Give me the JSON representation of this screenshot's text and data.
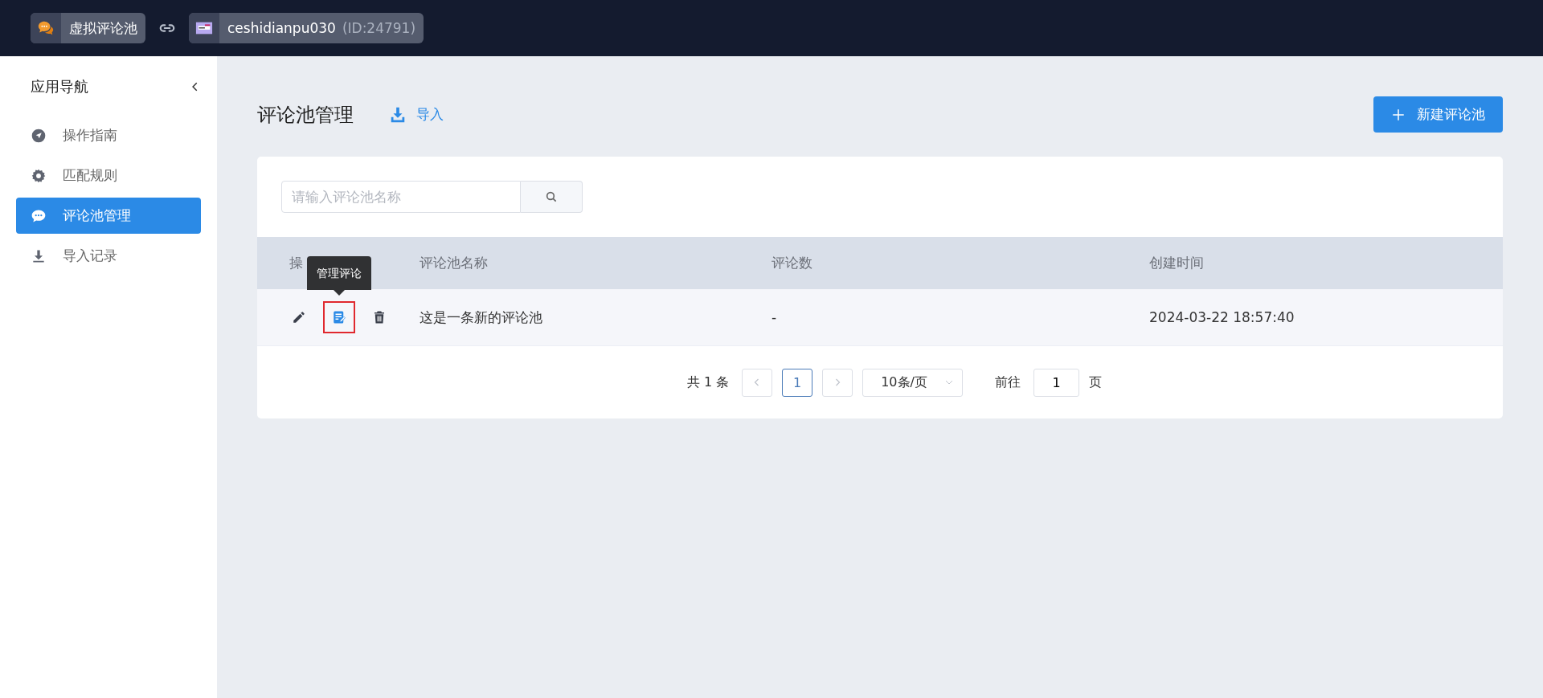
{
  "top_bar": {
    "app_chip": {
      "label": "虚拟评论池"
    },
    "shop_chip": {
      "name": "ceshidianpu030",
      "id_text": "(ID:24791)"
    }
  },
  "sidebar": {
    "title": "应用导航",
    "items": [
      {
        "label": "操作指南",
        "kind": "guide",
        "selected": false
      },
      {
        "label": "匹配规则",
        "kind": "rules",
        "selected": false
      },
      {
        "label": "评论池管理",
        "kind": "comments",
        "selected": true
      },
      {
        "label": "导入记录",
        "kind": "imports",
        "selected": false
      }
    ]
  },
  "page": {
    "title": "评论池管理",
    "import_link": "导入",
    "new_button": "新建评论池"
  },
  "search": {
    "placeholder": "请输入评论池名称"
  },
  "table": {
    "columns": [
      "操",
      "评论池名称",
      "评论数",
      "创建时间"
    ],
    "rows": [
      {
        "actions": [
          {
            "kind": "edit",
            "highlighted": false
          },
          {
            "kind": "manage",
            "highlighted": true
          },
          {
            "kind": "delete",
            "highlighted": false
          }
        ],
        "name": "这是一条新的评论池",
        "count": "-",
        "created": "2024-03-22 18:57:40"
      }
    ]
  },
  "tooltip": {
    "text": "管理评论"
  },
  "pagination": {
    "total": "共 1 条",
    "pages": [
      {
        "label": "1",
        "selected": true
      }
    ],
    "page_size": "10条/页",
    "goto_label": "前往",
    "goto_value": "1",
    "page_unit": "页"
  }
}
